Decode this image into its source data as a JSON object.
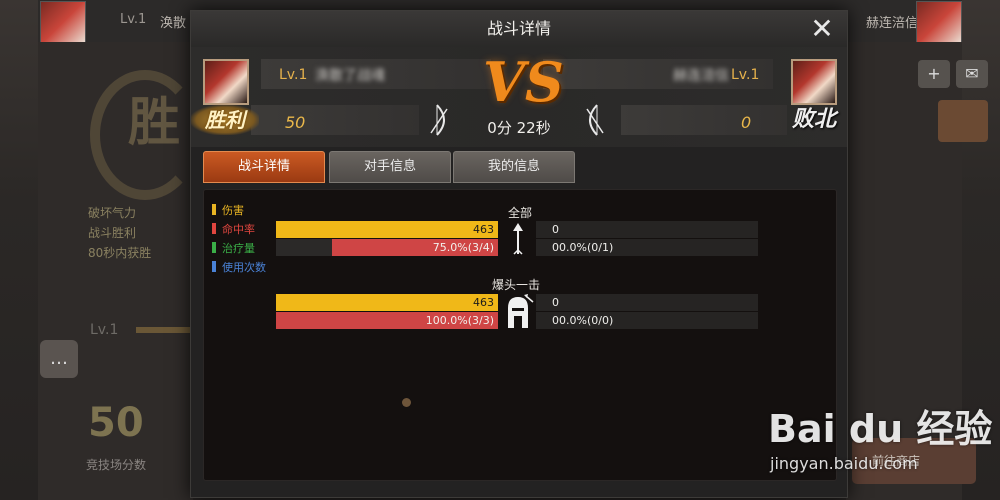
{
  "background": {
    "left_player_level": "Lv.1",
    "left_player_name": "涣散",
    "right_player_name": "赫连涪信",
    "victory_text": "胜",
    "stats": [
      "破坏气力",
      "战斗胜利",
      "80秒内获胜"
    ],
    "bottom_level": "Lv.1",
    "arena_score": "50",
    "arena_score_label": "竞技场分数",
    "shop_button": "前往商店"
  },
  "modal": {
    "title": "战斗详情",
    "close_glyph": "✕"
  },
  "match": {
    "player1": {
      "level": "Lv.1",
      "name": "涣散了战魂",
      "score": "50",
      "result": "胜利"
    },
    "player2": {
      "level": "Lv.1",
      "name": "赫连涪信",
      "score": "0",
      "result": "败北"
    },
    "vs": "VS",
    "duration": "0分 22秒"
  },
  "tabs": [
    {
      "label": "战斗详情",
      "active": true
    },
    {
      "label": "对手信息",
      "active": false
    },
    {
      "label": "我的信息",
      "active": false
    }
  ],
  "legend": [
    {
      "label": "伤害",
      "color": "#e8b423"
    },
    {
      "label": "命中率",
      "color": "#e0463f"
    },
    {
      "label": "治疗量",
      "color": "#3aae47"
    },
    {
      "label": "使用次数",
      "color": "#4a82d6"
    }
  ],
  "sections": {
    "all": {
      "title": "全部",
      "left": [
        {
          "text": "463",
          "fraction": 1.0,
          "color": "#f0b818"
        },
        {
          "text": "75.0%(3/4)",
          "fraction": 0.75,
          "color": "#cf4545"
        }
      ],
      "right": [
        {
          "text": "0"
        },
        {
          "text": "00.0%(0/1)"
        }
      ]
    },
    "headshot": {
      "title": "爆头一击",
      "left": [
        {
          "text": "463",
          "fraction": 1.0,
          "color": "#f0b818"
        },
        {
          "text": "100.0%(3/3)",
          "fraction": 1.0,
          "color": "#cf4545"
        }
      ],
      "right": [
        {
          "text": "0"
        },
        {
          "text": "00.0%(0/0)"
        }
      ]
    }
  },
  "watermark": {
    "logo": "Bai du 经验",
    "url": "jingyan.baidu.com"
  }
}
